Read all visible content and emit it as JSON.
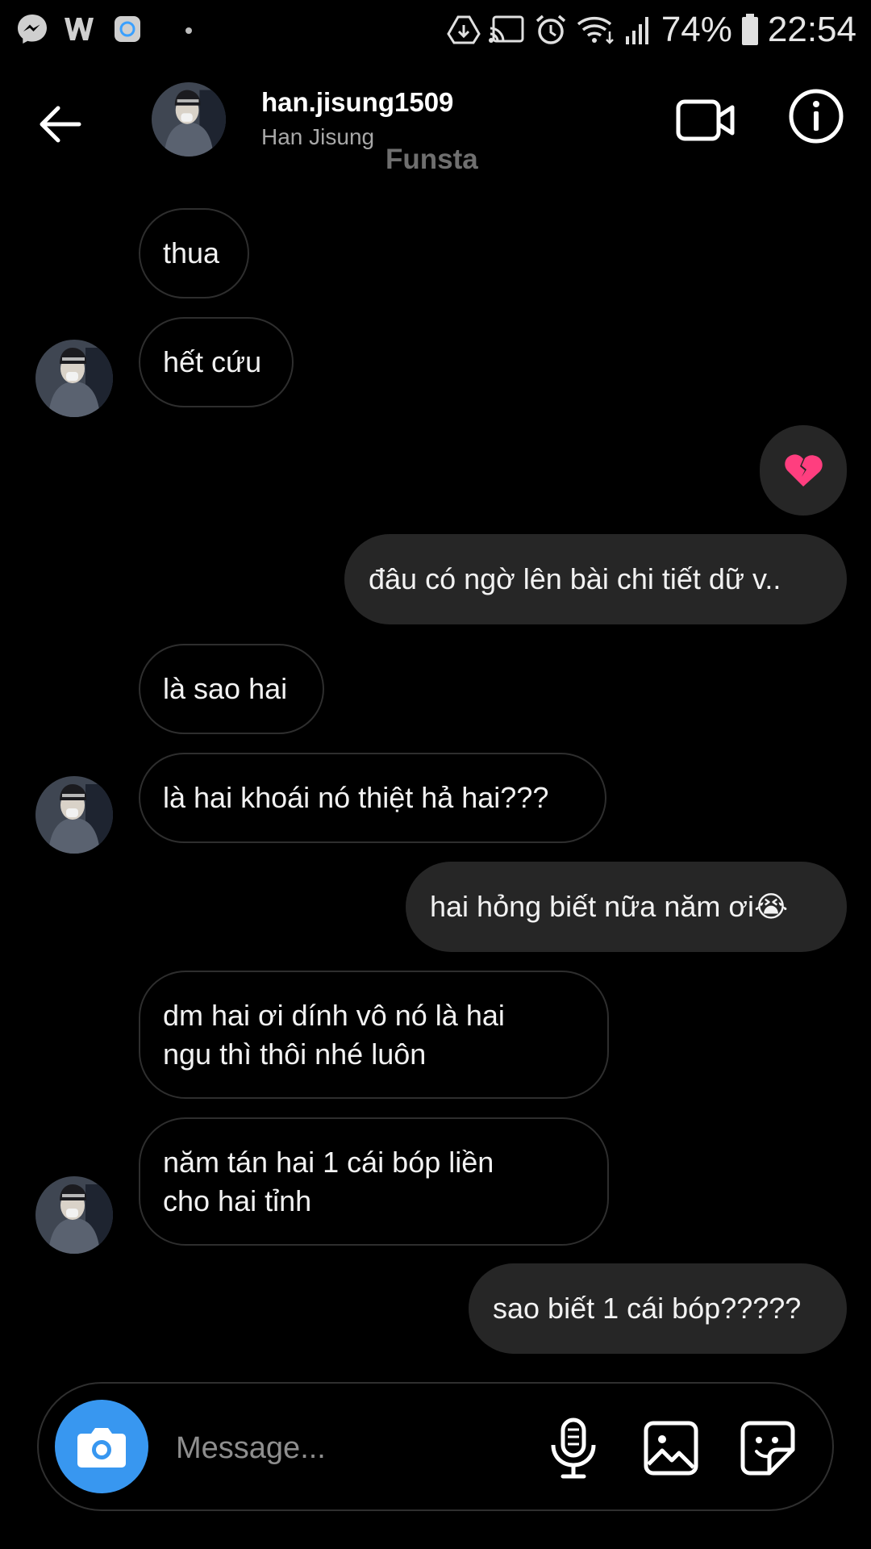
{
  "status_bar": {
    "left_icons": [
      "messenger-icon",
      "w-app-icon",
      "app-icon",
      "notification-dot"
    ],
    "right_icons": [
      "drive-icon",
      "cast-icon",
      "alarm-icon",
      "wifi-icon",
      "signal-icon",
      "battery-icon"
    ],
    "battery": "74%",
    "time": "22:54"
  },
  "header": {
    "username": "han.jisung1509",
    "full_name": "Han Jisung",
    "watermark": "Funsta",
    "icons": [
      "back-arrow-icon",
      "video-call-icon",
      "info-icon"
    ]
  },
  "messages": [
    {
      "side": "received",
      "text": "thua"
    },
    {
      "side": "received",
      "text": "hết cứu"
    },
    {
      "side": "sent",
      "text": "💔"
    },
    {
      "side": "sent",
      "text": "đâu có ngờ lên bài chi tiết dữ v.."
    },
    {
      "side": "received",
      "text": "là sao hai"
    },
    {
      "side": "received",
      "text": "là hai khoái nó thiệt hả hai???"
    },
    {
      "side": "sent",
      "text": "hai hỏng biết nữa năm ơi😭"
    },
    {
      "side": "received",
      "text": "dm hai ơi dính vô nó là hai\nngu thì thôi nhé luôn"
    },
    {
      "side": "received",
      "text": "năm tán hai 1 cái bóp liền\ncho hai tỉnh"
    },
    {
      "side": "sent",
      "text": "sao biết 1 cái bóp?????"
    }
  ],
  "composer": {
    "placeholder": "Message...",
    "icons": [
      "camera-icon",
      "microphone-icon",
      "gallery-icon",
      "sticker-icon"
    ]
  },
  "colors": {
    "background": "#000000",
    "sent_bubble": "#262626",
    "received_border": "#2e2e2e",
    "camera_button": "#3897f0",
    "secondary_text": "#a8a8a8"
  }
}
